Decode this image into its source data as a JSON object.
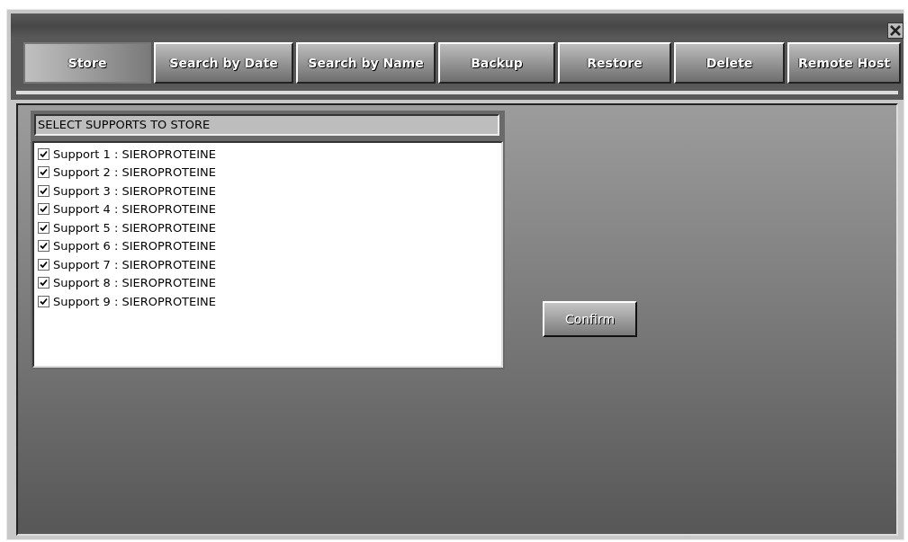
{
  "tabs": [
    {
      "label": "Store",
      "selected": true
    },
    {
      "label": "Search by Date",
      "selected": false
    },
    {
      "label": "Search by Name",
      "selected": false
    },
    {
      "label": "Backup",
      "selected": false
    },
    {
      "label": "Restore",
      "selected": false
    },
    {
      "label": "Delete",
      "selected": false
    },
    {
      "label": "Remote Host",
      "selected": false
    }
  ],
  "supports": {
    "header": "SELECT SUPPORTS TO STORE",
    "items": [
      {
        "label": "Support 1 : SIEROPROTEINE",
        "checked": true
      },
      {
        "label": "Support 2 : SIEROPROTEINE",
        "checked": true
      },
      {
        "label": "Support 3 : SIEROPROTEINE",
        "checked": true
      },
      {
        "label": "Support 4 : SIEROPROTEINE",
        "checked": true
      },
      {
        "label": "Support 5 : SIEROPROTEINE",
        "checked": true
      },
      {
        "label": "Support 6 : SIEROPROTEINE",
        "checked": true
      },
      {
        "label": "Support 7 : SIEROPROTEINE",
        "checked": true
      },
      {
        "label": "Support 8 : SIEROPROTEINE",
        "checked": true
      },
      {
        "label": "Support 9 : SIEROPROTEINE",
        "checked": true
      }
    ]
  },
  "confirm_button": "Confirm"
}
